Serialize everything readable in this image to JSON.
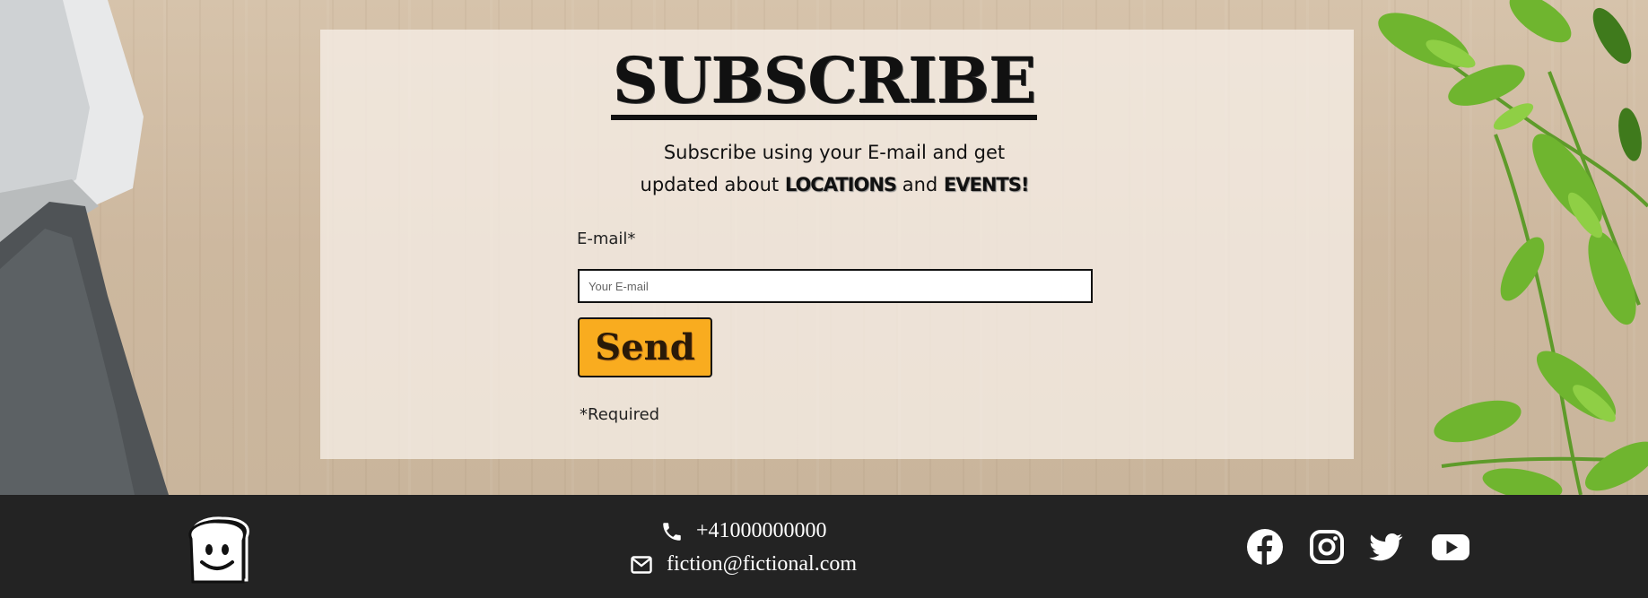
{
  "subscribe": {
    "title": "SUBSCRIBE",
    "intro_line1": "Subscribe using your E-mail and get",
    "intro_line2_start": "updated about ",
    "intro_highlight1": "LOCATIONS",
    "intro_line2_mid": " and ",
    "intro_highlight2": "EVENTS!",
    "email_label": "E-mail*",
    "email_placeholder": "Your E-mail",
    "email_value": "",
    "send_label": "Send",
    "required_note": "*Required"
  },
  "footer": {
    "logo_icon": "toast-logo-icon",
    "phone_icon": "phone-icon",
    "phone": "+41000000000",
    "mail_icon": "envelope-icon",
    "email": "fiction@fictional.com",
    "social": [
      "facebook-icon",
      "instagram-icon",
      "twitter-icon",
      "youtube-icon"
    ]
  },
  "colors": {
    "panel": "#f6eee7",
    "button": "#f9ac1f",
    "footer": "#232323",
    "text": "#111111",
    "footer_text": "#ffffff"
  }
}
